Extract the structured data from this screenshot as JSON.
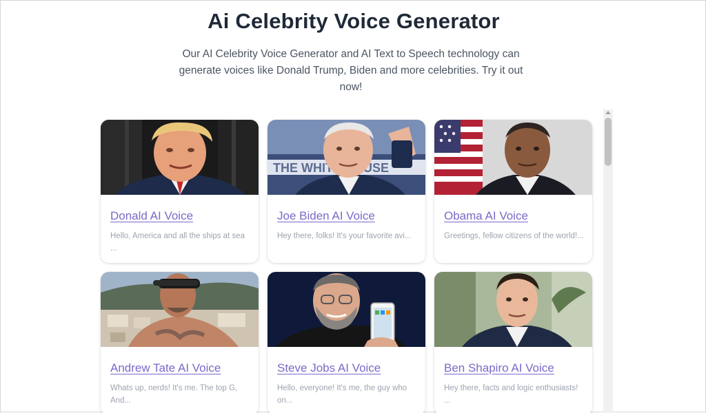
{
  "page": {
    "title": "Ai Celebrity Voice Generator",
    "subtitle": "Our AI Celebrity Voice Generator and AI Text to Speech technology can generate voices like Donald Trump, Biden and more celebrities. Try it out now!"
  },
  "colors": {
    "link": "#7c68c8",
    "heading": "#1f2937",
    "muted": "#9ca3af"
  },
  "cards": [
    {
      "title": "Donald AI Voice",
      "description": "Hello, America and all the ships at sea ...",
      "image": "donald-trump-photo"
    },
    {
      "title": "Joe Biden AI Voice",
      "description": "Hey there, folks! It's your favorite avi...",
      "image": "joe-biden-photo"
    },
    {
      "title": "Obama AI Voice",
      "description": "Greetings, fellow citizens of the world!...",
      "image": "obama-photo"
    },
    {
      "title": "Andrew Tate AI Voice",
      "description": "Whats up, nerds! It's me. The top G, And...",
      "image": "andrew-tate-photo"
    },
    {
      "title": "Steve Jobs AI Voice",
      "description": "Hello, everyone! It's me, the guy who on...",
      "image": "steve-jobs-photo"
    },
    {
      "title": "Ben Shapiro AI Voice",
      "description": "Hey there, facts and logic enthusiasts! ...",
      "image": "ben-shapiro-photo"
    }
  ]
}
